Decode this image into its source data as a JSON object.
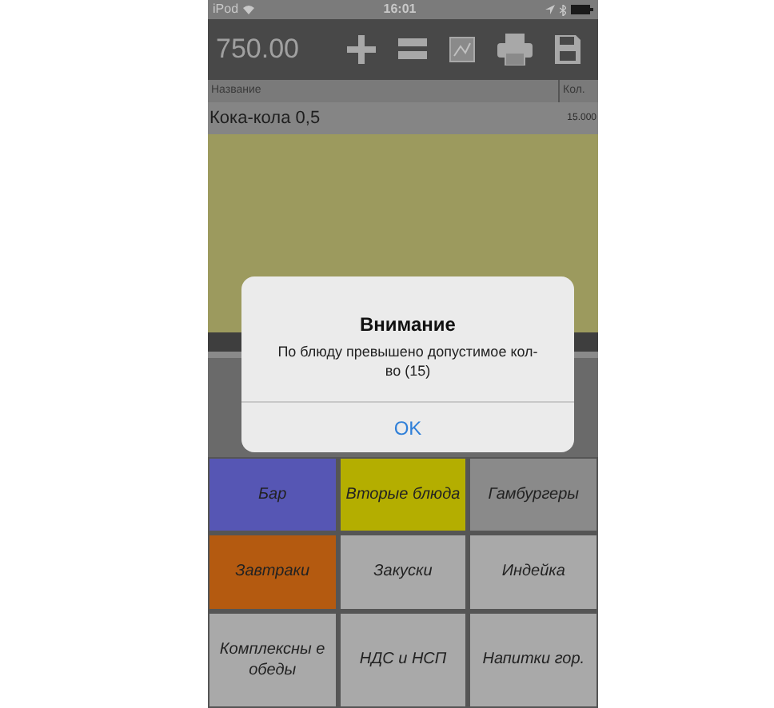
{
  "status_bar": {
    "carrier": "iPod",
    "time": "16:01"
  },
  "toolbar": {
    "total": "750.00"
  },
  "table": {
    "columns": [
      "Название",
      "Кол."
    ],
    "rows": [
      {
        "name": "Кока-кола 0,5",
        "qty": "15.000"
      }
    ]
  },
  "categories": [
    {
      "label": "Бар",
      "color": "#5656b4"
    },
    {
      "label": "Вторые блюда",
      "color": "#b4ae00"
    },
    {
      "label": "Гамбургеры",
      "color": "#8a8a8a"
    },
    {
      "label": "Завтраки",
      "color": "#b45a10"
    },
    {
      "label": "Закуски",
      "color": "#a9a9a9"
    },
    {
      "label": "Индейка",
      "color": "#a9a9a9"
    },
    {
      "label": "Комплексны е обеды",
      "color": "#a9a9a9"
    },
    {
      "label": "НДС и НСП",
      "color": "#a9a9a9"
    },
    {
      "label": "Напитки гор.",
      "color": "#a9a9a9"
    }
  ],
  "alert": {
    "title": "Внимание",
    "message": "По блюду превышено допустимое кол-во (15)",
    "button": "OK"
  }
}
